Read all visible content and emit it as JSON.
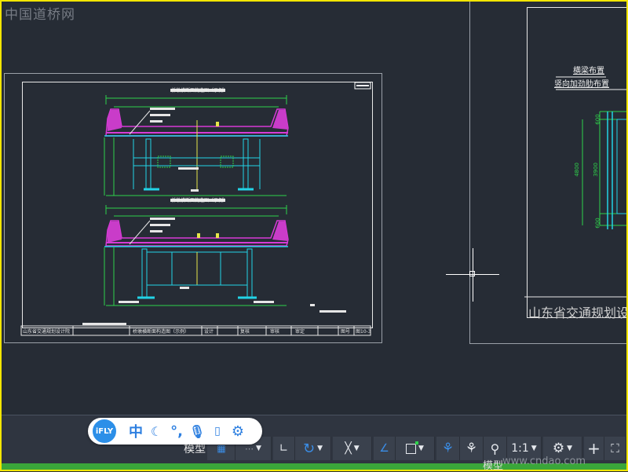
{
  "watermark": "中国道桥网",
  "sheet1": {
    "section_title_top": "桥墩横断面构造图（示例）",
    "section_title_bottom": "桥墩横断面构造图（示例）",
    "footer_company": "山东省交通规划设计院",
    "footer_drawing": "桥墩横断面构造图（示例）",
    "footer_cells": [
      "设计",
      "复核",
      "审核",
      "审定",
      "图号",
      "图10-3"
    ]
  },
  "sheet2": {
    "title": "山东省交通规划设计",
    "note1": "横梁布置",
    "note2": "竖向加劲肋布置",
    "dims": [
      "4800",
      "3900",
      "600",
      "600"
    ]
  },
  "statusbar": {
    "model_label": "模型",
    "scale_label": "1:1",
    "bottom_text": "模型",
    "site": "www.cndao.com"
  },
  "ime": {
    "logo": "iFLY",
    "mode": "中"
  },
  "colors": {
    "frame": "#f3e600",
    "canvas": "#262c35",
    "magenta": "#d73ad7",
    "cyan": "#22d3e6",
    "green": "#2fd24b",
    "yellow": "#e6e64a",
    "accent_blue": "#2c8fe8"
  }
}
